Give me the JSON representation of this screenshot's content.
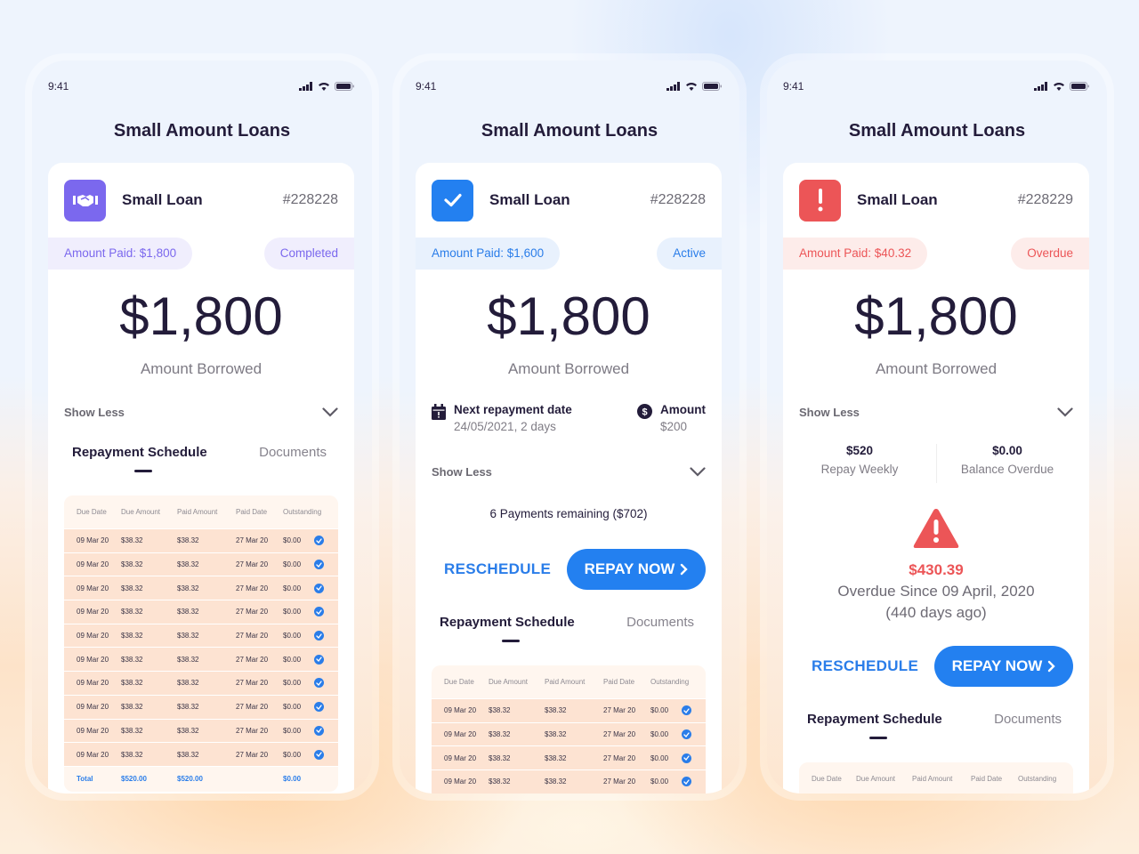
{
  "phones": [
    {
      "status": {
        "time": "9:41"
      },
      "title": "Small Amount Loans",
      "card": {
        "name": "Small Loan",
        "id": "#228228",
        "icon": "handshake-icon",
        "accent": "#7b68ee",
        "amount_paid": "Amount Paid: $1,800",
        "status": "Completed",
        "amount": "$1,800",
        "amount_label": "Amount Borrowed",
        "show_less": "Show Less",
        "tabs": {
          "active": "Repayment Schedule",
          "other": "Documents"
        },
        "table": {
          "headers": [
            "Due Date",
            "Due Amount",
            "Paid Amount",
            "Paid Date",
            "Outstanding"
          ],
          "rows": [
            [
              "09 Mar 20",
              "$38.32",
              "$38.32",
              "27 Mar 20",
              "$0.00"
            ],
            [
              "09 Mar 20",
              "$38.32",
              "$38.32",
              "27 Mar 20",
              "$0.00"
            ],
            [
              "09 Mar 20",
              "$38.32",
              "$38.32",
              "27 Mar 20",
              "$0.00"
            ],
            [
              "09 Mar 20",
              "$38.32",
              "$38.32",
              "27 Mar 20",
              "$0.00"
            ],
            [
              "09 Mar 20",
              "$38.32",
              "$38.32",
              "27 Mar 20",
              "$0.00"
            ],
            [
              "09 Mar 20",
              "$38.32",
              "$38.32",
              "27 Mar 20",
              "$0.00"
            ],
            [
              "09 Mar 20",
              "$38.32",
              "$38.32",
              "27 Mar 20",
              "$0.00"
            ],
            [
              "09 Mar 20",
              "$38.32",
              "$38.32",
              "27 Mar 20",
              "$0.00"
            ],
            [
              "09 Mar 20",
              "$38.32",
              "$38.32",
              "27 Mar 20",
              "$0.00"
            ],
            [
              "09 Mar 20",
              "$38.32",
              "$38.32",
              "27 Mar 20",
              "$0.00"
            ]
          ],
          "total": [
            "Total",
            "$520.00",
            "$520.00",
            "",
            "$0.00"
          ]
        }
      }
    },
    {
      "status": {
        "time": "9:41"
      },
      "title": "Small Amount Loans",
      "card": {
        "name": "Small Loan",
        "id": "#228228",
        "icon": "check-icon",
        "accent": "#2380f0",
        "amount_paid": "Amount Paid: $1,600",
        "status": "Active",
        "amount": "$1,800",
        "amount_label": "Amount Borrowed",
        "next_repayment": {
          "title": "Next repayment date",
          "value": "24/05/2021, 2 days"
        },
        "repay_amount": {
          "title": "Amount",
          "value": "$200"
        },
        "show_less": "Show Less",
        "payments_remaining": "6 Payments remaining ($702)",
        "reschedule": "RESCHEDULE",
        "repay_now": "REPAY NOW",
        "tabs": {
          "active": "Repayment Schedule",
          "other": "Documents"
        },
        "table": {
          "headers": [
            "Due Date",
            "Due Amount",
            "Paid Amount",
            "Paid Date",
            "Outstanding"
          ],
          "rows": [
            [
              "09 Mar 20",
              "$38.32",
              "$38.32",
              "27 Mar 20",
              "$0.00"
            ],
            [
              "09 Mar 20",
              "$38.32",
              "$38.32",
              "27 Mar 20",
              "$0.00"
            ],
            [
              "09 Mar 20",
              "$38.32",
              "$38.32",
              "27 Mar 20",
              "$0.00"
            ],
            [
              "09 Mar 20",
              "$38.32",
              "$38.32",
              "27 Mar 20",
              "$0.00"
            ]
          ]
        }
      }
    },
    {
      "status": {
        "time": "9:41"
      },
      "title": "Small Amount Loans",
      "card": {
        "name": "Small Loan",
        "id": "#228229",
        "icon": "exclamation-icon",
        "accent": "#ec5557",
        "amount_paid": "Amount Paid: $40.32",
        "status": "Overdue",
        "amount": "$1,800",
        "amount_label": "Amount Borrowed",
        "show_less": "Show Less",
        "stats": [
          {
            "value": "$520",
            "label": "Repay Weekly"
          },
          {
            "value": "$0.00",
            "label": "Balance Overdue"
          }
        ],
        "overdue_amount": "$430.39",
        "overdue_since": "Overdue Since 09 April, 2020",
        "overdue_days": "(440 days ago)",
        "reschedule": "RESCHEDULE",
        "repay_now": "REPAY NOW",
        "tabs": {
          "active": "Repayment Schedule",
          "other": "Documents"
        },
        "table": {
          "headers": [
            "Due Date",
            "Due Amount",
            "Paid Amount",
            "Paid Date",
            "Outstanding"
          ]
        }
      }
    }
  ],
  "colors": {
    "completed_pill_bg": "#f0eefd",
    "completed_pill_text": "#7b68ee",
    "active_pill_bg": "#e8f1fd",
    "active_pill_text": "#2a7de9",
    "overdue_pill_bg": "#fdecea",
    "overdue_pill_text": "#ec5557",
    "primary": "#2380f0"
  }
}
